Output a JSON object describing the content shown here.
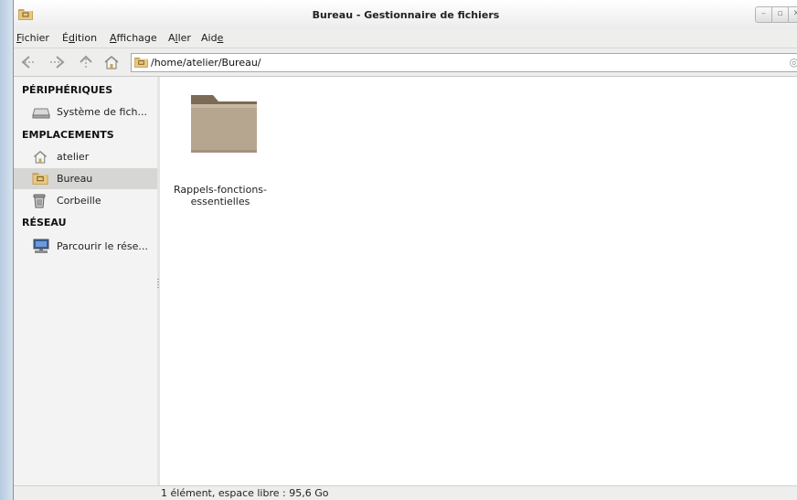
{
  "window": {
    "title": "Bureau - Gestionnaire de fichiers"
  },
  "window_controls": [
    "minimize",
    "maximize",
    "close"
  ],
  "menubar": {
    "items": [
      {
        "pre": "",
        "mn": "F",
        "post": "ichier"
      },
      {
        "pre": "É",
        "mn": "d",
        "post": "ition"
      },
      {
        "pre": "",
        "mn": "A",
        "post": "ffichage"
      },
      {
        "pre": "A",
        "mn": "l",
        "post": "ler"
      },
      {
        "pre": "Aid",
        "mn": "e",
        "post": ""
      }
    ]
  },
  "toolbar": {
    "buttons": [
      "back-icon",
      "forward-icon",
      "up-icon",
      "home-icon"
    ],
    "location_path": "/home/atelier/Bureau/"
  },
  "sidebar": {
    "sections": [
      {
        "title": "PÉRIPHÉRIQUES",
        "items": [
          {
            "label": "Système de fich...",
            "icon": "drive-icon"
          }
        ]
      },
      {
        "title": "EMPLACEMENTS",
        "items": [
          {
            "label": "atelier",
            "icon": "home-icon"
          },
          {
            "label": "Bureau",
            "icon": "desktop-folder-icon",
            "selected": true
          },
          {
            "label": "Corbeille",
            "icon": "trash-icon"
          }
        ]
      },
      {
        "title": "RÉSEAU",
        "items": [
          {
            "label": "Parcourir le rése...",
            "icon": "network-icon"
          }
        ]
      }
    ]
  },
  "content": {
    "files": [
      {
        "name_line1": "Rappels-fonctions-",
        "name_line2": "essentielles",
        "icon": "folder-icon"
      }
    ]
  },
  "status": {
    "text": "1 élément, espace libre : 95,6 Go"
  },
  "colors": {
    "selected_bg": "#d6d6d4",
    "folder": "#b9a78e",
    "window_bg": "#eeeeec"
  }
}
